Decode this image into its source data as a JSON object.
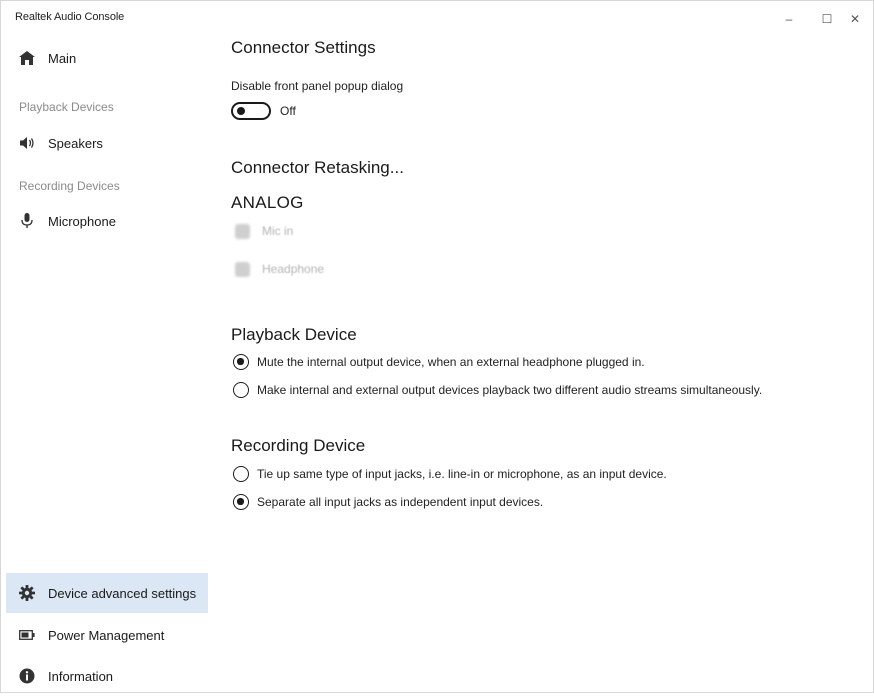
{
  "window": {
    "title": "Realtek Audio Console",
    "minimize_glyph": "–",
    "maximize_glyph": "☐",
    "close_glyph": "✕"
  },
  "sidebar": {
    "main_label": "Main",
    "playback_section": "Playback Devices",
    "speakers_label": "Speakers",
    "recording_section": "Recording Devices",
    "microphone_label": "Microphone",
    "device_advanced_label": "Device advanced settings",
    "power_label": "Power Management",
    "information_label": "Information",
    "active_item": "device-advanced-settings",
    "icons": {
      "main": "home-icon",
      "speakers": "speaker-icon",
      "microphone": "microphone-icon",
      "device_advanced": "gear-icon",
      "power": "battery-icon",
      "information": "info-icon"
    }
  },
  "content": {
    "connector_settings_title": "Connector Settings",
    "disable_popup_label": "Disable front panel popup dialog",
    "toggle_state": "Off",
    "connector_retasking_title": "Connector Retasking...",
    "analog_title": "ANALOG",
    "analog_jacks": [
      {
        "label": "Mic in"
      },
      {
        "label": "Headphone"
      }
    ],
    "playback_device_title": "Playback Device",
    "playback_options": [
      {
        "label": "Mute the internal output device, when an external headphone plugged in.",
        "selected": true
      },
      {
        "label": "Make internal and external output devices playback two different audio streams simultaneously.",
        "selected": false
      }
    ],
    "recording_device_title": "Recording Device",
    "recording_options": [
      {
        "label": "Tie up same type of input jacks, i.e. line-in or microphone, as an input device.",
        "selected": false
      },
      {
        "label": "Separate all input jacks as independent input devices.",
        "selected": true
      }
    ]
  },
  "colors": {
    "active_nav_background": "#dbe7f4",
    "section_label": "#8a8a8a",
    "text": "#1a1a1a"
  }
}
